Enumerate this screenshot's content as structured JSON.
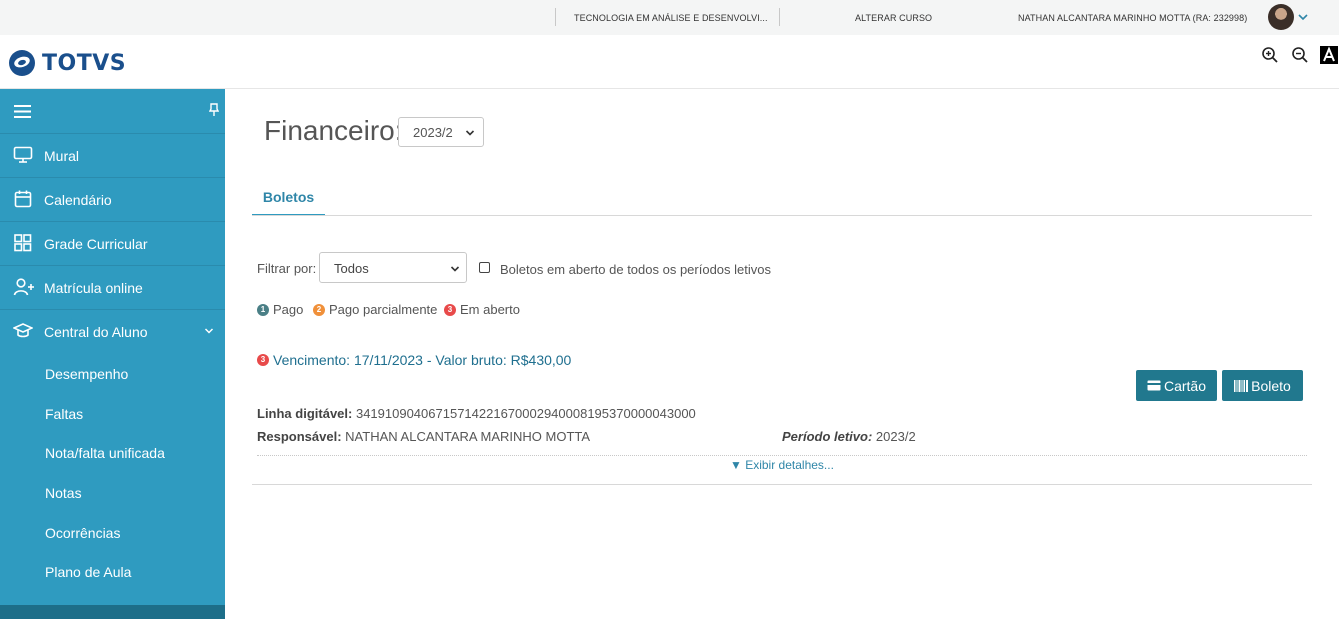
{
  "topbar": {
    "course": "TECNOLOGIA EM ANÁLISE E DESENVOLVI...",
    "change_course": "ALTERAR CURSO",
    "user": "NATHAN ALCANTARA MARINHO MOTTA (RA: 232998)"
  },
  "header": {
    "logo": "TOTVS",
    "icons": [
      "zoom-in-icon",
      "zoom-out-icon",
      "contrast-icon"
    ]
  },
  "sidebar": {
    "items": [
      {
        "label": "Mural",
        "icon": "monitor-icon"
      },
      {
        "label": "Calendário",
        "icon": "calendar-icon"
      },
      {
        "label": "Grade Curricular",
        "icon": "grid-icon"
      },
      {
        "label": "Matrícula online",
        "icon": "add-user-icon"
      },
      {
        "label": "Central do Aluno",
        "icon": "graduation-cap-icon"
      }
    ],
    "subitems": [
      "Desempenho",
      "Faltas",
      "Nota/falta unificada",
      "Notas",
      "Ocorrências",
      "Plano de Aula"
    ]
  },
  "main": {
    "title": "Financeiro:",
    "year": "2023/2",
    "tab": "Boletos",
    "filter_label": "Filtrar por:",
    "filter_value": "Todos",
    "checkbox_label": "Boletos em aberto de todos os períodos letivos",
    "legend": [
      {
        "num": "1",
        "label": "Pago",
        "color": "#4a7f86"
      },
      {
        "num": "2",
        "label": "Pago parcialmente",
        "color": "#f0903a"
      },
      {
        "num": "3",
        "label": "Em aberto",
        "color": "#e84a4a"
      }
    ],
    "boleto": {
      "status_num": "3",
      "heading": "Vencimento: 17/11/2023 - Valor bruto: R$430,00",
      "linha_label": "Linha digitável:",
      "linha_value": "34191090406715714221670002940008195370000043000",
      "resp_label": "Responsável:",
      "resp_value": "NATHAN ALCANTARA MARINHO MOTTA",
      "periodo_label": "Período letivo:",
      "periodo_value": "2023/2",
      "details": "▼ Exibir detalhes...",
      "btn_card": "Cartão",
      "btn_boleto": "Boleto"
    }
  },
  "colors": {
    "sidebar": "#2f9bc0",
    "button": "#21788e",
    "accent_text": "#1f6f8f"
  }
}
